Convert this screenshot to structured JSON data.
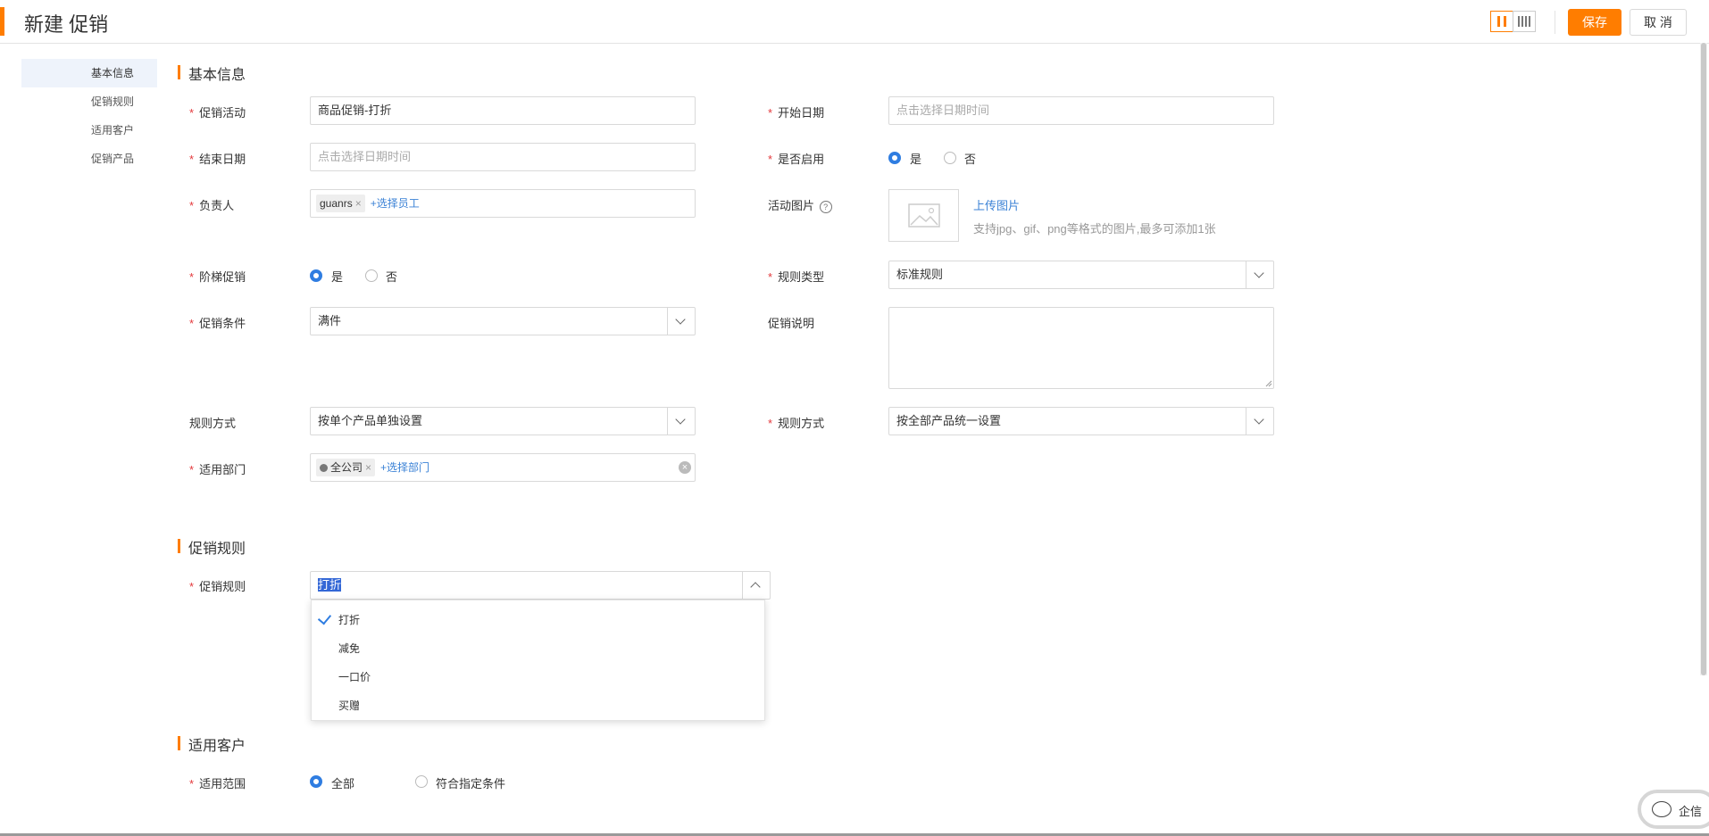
{
  "header": {
    "title": "新建 促销",
    "save_label": "保存",
    "cancel_label": "取 消"
  },
  "sidebar": {
    "items": [
      "基本信息",
      "促销规则",
      "适用客户",
      "促销产品"
    ],
    "active": 0
  },
  "sections": {
    "basic": "基本信息",
    "rules": "促销规则",
    "customers": "适用客户"
  },
  "form": {
    "promotion_activity": {
      "label": "促销活动",
      "value": "商品促销-打折"
    },
    "start_date": {
      "label": "开始日期",
      "placeholder": "点击选择日期时间"
    },
    "end_date": {
      "label": "结束日期",
      "placeholder": "点击选择日期时间"
    },
    "enabled": {
      "label": "是否启用",
      "options": [
        "是",
        "否"
      ],
      "selected": "是"
    },
    "owner": {
      "label": "负责人",
      "tag": "guanrs",
      "add_link": "+选择员工"
    },
    "activity_image": {
      "label": "活动图片",
      "upload_link": "上传图片",
      "hint": "支持jpg、gif、png等格式的图片,最多可添加1张"
    },
    "tiered": {
      "label": "阶梯促销",
      "options": [
        "是",
        "否"
      ],
      "selected": "是"
    },
    "rule_type": {
      "label": "规则类型",
      "value": "标准规则"
    },
    "condition": {
      "label": "促销条件",
      "value": "满件"
    },
    "description": {
      "label": "促销说明",
      "value": ""
    },
    "rule_method_left": {
      "label": "规则方式",
      "value": "按单个产品单独设置"
    },
    "rule_method_right": {
      "label": "规则方式",
      "value": "按全部产品统一设置"
    },
    "department": {
      "label": "适用部门",
      "tag": "全公司",
      "add_link": "+选择部门"
    },
    "promotion_rule": {
      "label": "促销规则",
      "value": "打折",
      "options": [
        "打折",
        "减免",
        "一口价",
        "买赠"
      ],
      "selected": "打折"
    },
    "scope": {
      "label": "适用范围",
      "options": [
        "全部",
        "符合指定条件"
      ],
      "selected": "全部"
    }
  },
  "chat": {
    "label": "企信"
  },
  "colors": {
    "accent": "#ff7d00",
    "link": "#3b82d6",
    "radio": "#2f7de1",
    "required": "#e4393c"
  }
}
